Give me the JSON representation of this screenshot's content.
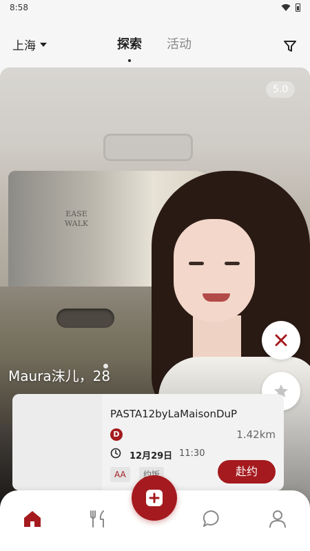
{
  "status_bar": {
    "time": "8:58"
  },
  "header": {
    "city": "上海",
    "tabs": [
      {
        "label": "探索",
        "active": true
      },
      {
        "label": "活动",
        "active": false
      }
    ]
  },
  "profile": {
    "rating": "5.0",
    "name_age": "Maura沫儿，28"
  },
  "event": {
    "venue": "PASTA12byLaMaisonDuP",
    "badge": "D",
    "distance": "1.42km",
    "date": "12月29日",
    "time": "11:30",
    "tags": [
      "AA",
      "约饭"
    ],
    "join_label": "赴约"
  },
  "bottom_nav": {
    "items": [
      "home-icon",
      "dining-icon",
      "add-icon",
      "chat-icon",
      "profile-icon"
    ]
  },
  "colors": {
    "accent": "#a41a1e",
    "background": "#f6f6f6",
    "text": "#222222"
  }
}
